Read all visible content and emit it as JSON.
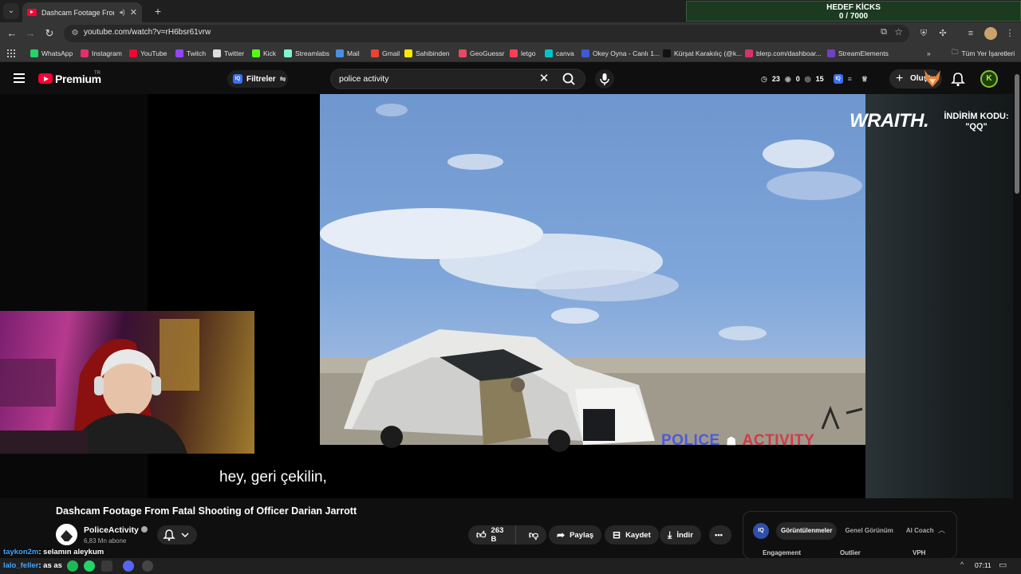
{
  "browser": {
    "tab_title": "Dashcam Footage From Fatal Shooting of Officer Darian Jarrott",
    "url": "youtube.com/watch?v=rH6bsr61vrw",
    "goal_label": "HEDEF KİCKS",
    "goal_value": "0 / 7000",
    "bookmarks": [
      {
        "label": "WhatsApp",
        "color": "#25d366"
      },
      {
        "label": "Instagram",
        "color": "#e1306c"
      },
      {
        "label": "YouTube",
        "color": "#ff0033"
      },
      {
        "label": "Twitch",
        "color": "#9146ff"
      },
      {
        "label": "Twitter",
        "color": "#dddddd"
      },
      {
        "label": "Kick",
        "color": "#53fc18"
      },
      {
        "label": "Streamlabs",
        "color": "#80f5d2"
      },
      {
        "label": "Mail",
        "color": "#4a90e2"
      },
      {
        "label": "Gmail",
        "color": "#ea4335"
      },
      {
        "label": "Sahibinden",
        "color": "#ffe800"
      },
      {
        "label": "GeoGuessr",
        "color": "#e84a5f"
      },
      {
        "label": "letgo",
        "color": "#ff3f55"
      },
      {
        "label": "canva",
        "color": "#00c4cc"
      },
      {
        "label": "Okey Oyna - Canlı 1...",
        "color": "#3b5bdb"
      },
      {
        "label": "Kürşat Karakılıç (@k...",
        "color": "#111111"
      },
      {
        "label": "blerp.com/dashboar...",
        "color": "#d6336c"
      },
      {
        "label": "StreamElements",
        "color": "#6f42c1"
      }
    ],
    "all_bookmarks": "Tüm Yer İşaretleri"
  },
  "youtube": {
    "premium_label": "Premium",
    "region": "TR",
    "filters_label": "Filtreler",
    "search_query": "police activity",
    "iq_stats": {
      "a": "23",
      "b": "0",
      "c": "15"
    },
    "create_label": "Oluştur",
    "avatar_letter": "K"
  },
  "player": {
    "subtitle": "hey, geri çekilin,",
    "sponsor_logo": "WRAITH.",
    "sponsor_line1": "İNDİRİM KODU:",
    "sponsor_line2": "\"QQ\"",
    "watermark_a": "POLICE",
    "watermark_b": "ACTIVITY"
  },
  "video": {
    "title": "Dashcam Footage From Fatal Shooting of Officer Darian Jarrott",
    "channel": "PoliceActivity",
    "subscribers": "6,83 Mn abone",
    "likes": "263 B",
    "share": "Paylaş",
    "save": "Kaydet",
    "download": "İndir"
  },
  "iq_panel": {
    "tabs": [
      "Görüntülenmeler",
      "Genel Görünüm",
      "AI Coach"
    ],
    "columns": [
      "Engagement",
      "Outlier",
      "VPH"
    ]
  },
  "chat": [
    {
      "user": "taykon2m",
      "message": ": selamın aleykum"
    },
    {
      "user": "lalo_feller",
      "message": ": as as"
    }
  ],
  "taskbar": {
    "time": "07:11"
  }
}
